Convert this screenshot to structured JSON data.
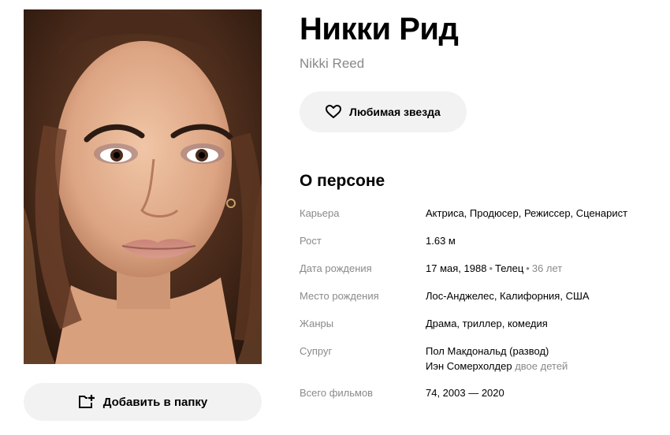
{
  "person": {
    "name_ru": "Никки Рид",
    "name_en": "Nikki Reed",
    "favorite_label": "Любимая звезда",
    "add_folder_label": "Добавить в папку"
  },
  "about": {
    "title": "О персоне",
    "career": {
      "label": "Карьера",
      "value": "Актриса, Продюсер, Режиссер, Сценарист"
    },
    "height": {
      "label": "Рост",
      "value": "1.63 м"
    },
    "birth_date": {
      "label": "Дата рождения",
      "date": "17 мая, 1988",
      "sign": "Телец",
      "age": "36 лет"
    },
    "birth_place": {
      "label": "Место рождения",
      "value": "Лос-Анджелес, Калифорния, США"
    },
    "genres": {
      "label": "Жанры",
      "value": "Драма, триллер, комедия"
    },
    "spouse": {
      "label": "Супруг",
      "first": "Пол Макдональд (развод)",
      "second": "Иэн Сомерхолдер",
      "second_note": "двое детей"
    },
    "films_total": {
      "label": "Всего фильмов",
      "value": "74, 2003 — 2020"
    }
  },
  "icons": {
    "favorite": "heart-outline-icon",
    "add_folder": "folder-plus-icon"
  }
}
